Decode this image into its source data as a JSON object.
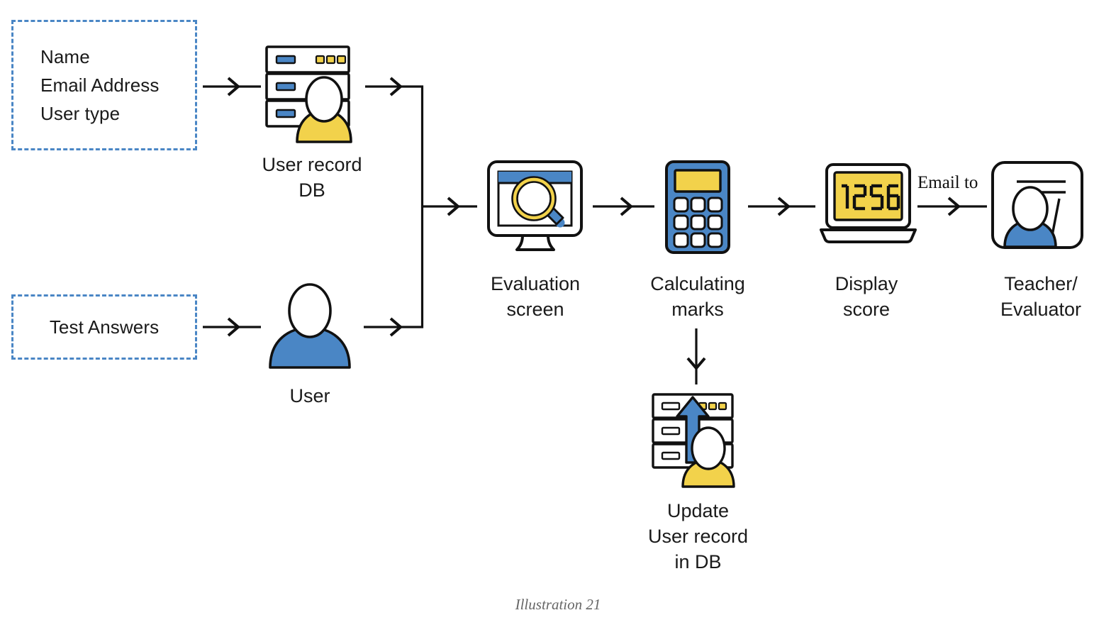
{
  "figure": {
    "caption": "Illustration 21",
    "colors": {
      "blue": "#4a86c5",
      "yellow": "#f2d24b",
      "outline": "#111111",
      "dashed_border": "#4a86c5",
      "caption_gray": "#666666"
    }
  },
  "inputs": {
    "user_record_fields": {
      "line1": "Name",
      "line2": "Email Address",
      "line3": "User type"
    },
    "test_answers": {
      "label": "Test Answers"
    }
  },
  "nodes": {
    "user_record_db": {
      "label": "User record\nDB",
      "icon": "server-user-icon"
    },
    "user": {
      "label": "User",
      "icon": "user-avatar-icon"
    },
    "evaluation_screen": {
      "label": "Evaluation\nscreen",
      "icon": "monitor-search-icon"
    },
    "calculating_marks": {
      "label": "Calculating\nmarks",
      "icon": "calculator-icon"
    },
    "display_score": {
      "label": "Display\nscore",
      "icon": "laptop-icon",
      "screen_value": "1256"
    },
    "teacher_evaluator": {
      "label": "Teacher/\nEvaluator",
      "icon": "teacher-board-icon"
    },
    "update_db": {
      "label": "Update\nUser record\nin DB",
      "icon": "server-upload-icon"
    }
  },
  "edges": {
    "fields_to_db": {
      "name": "arrow-fields-to-db",
      "label": ""
    },
    "db_to_junction": {
      "name": "arrow-db-to-junction",
      "label": ""
    },
    "answers_to_user": {
      "name": "arrow-answers-to-user",
      "label": ""
    },
    "user_to_junction": {
      "name": "arrow-user-to-junction",
      "label": ""
    },
    "junction_to_evaluation": {
      "name": "arrow-junction-to-evaluation",
      "label": ""
    },
    "evaluation_to_calculating": {
      "name": "arrow-evaluation-to-calculating",
      "label": ""
    },
    "calculating_to_display": {
      "name": "arrow-calculating-to-display",
      "label": ""
    },
    "display_to_teacher": {
      "name": "arrow-display-to-teacher",
      "label": "Email to"
    },
    "calculating_to_update": {
      "name": "arrow-calculating-to-update",
      "label": ""
    }
  }
}
